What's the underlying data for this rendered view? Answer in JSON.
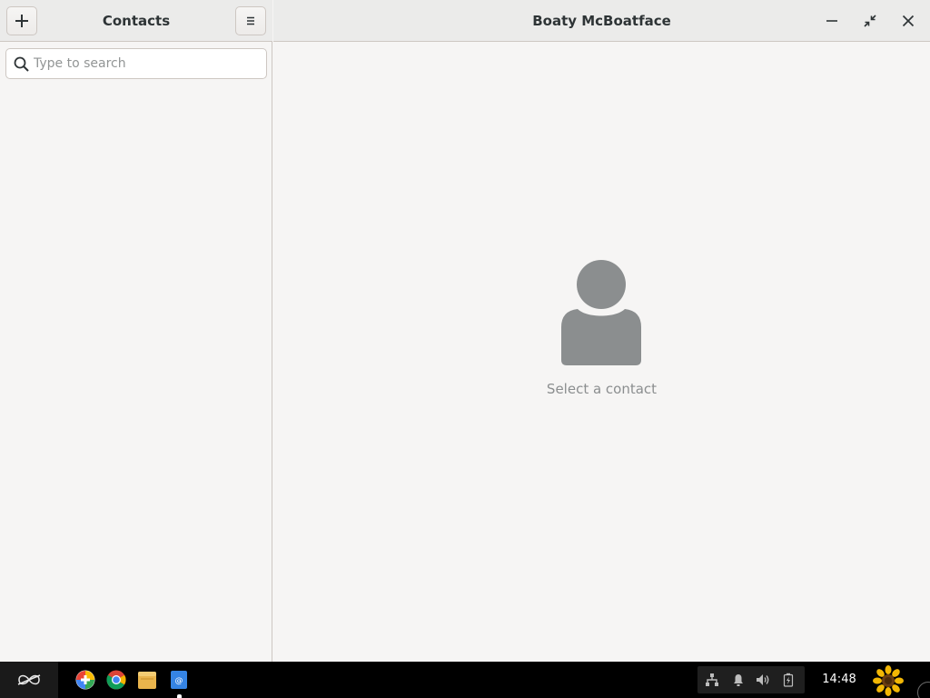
{
  "sidebar": {
    "title": "Contacts",
    "add_button": "plus-icon",
    "menu_button": "hamburger-icon",
    "search": {
      "placeholder": "Type to search",
      "value": "",
      "icon": "search-icon"
    }
  },
  "main": {
    "title": "Boaty McBoatface",
    "window_controls": [
      "minimize-icon",
      "restore-icon",
      "close-icon"
    ],
    "empty_state": {
      "icon": "person-icon",
      "text": "Select a contact"
    }
  },
  "taskbar": {
    "launcher_icon": "infinity-icon",
    "apps": [
      "app-grid-icon",
      "chrome-icon",
      "files-icon",
      "contacts-icon"
    ],
    "tray_icons": [
      "network-icon",
      "notification-icon",
      "volume-icon",
      "battery-icon"
    ],
    "clock": "14:48",
    "avatar": "sunflower-icon"
  },
  "colors": {
    "window_bg": "#f6f5f4",
    "header_bg": "#ebebea",
    "border": "#cdc7c2",
    "placeholder_avatar": "#8b8e8f",
    "taskbar_bg": "#000000"
  }
}
